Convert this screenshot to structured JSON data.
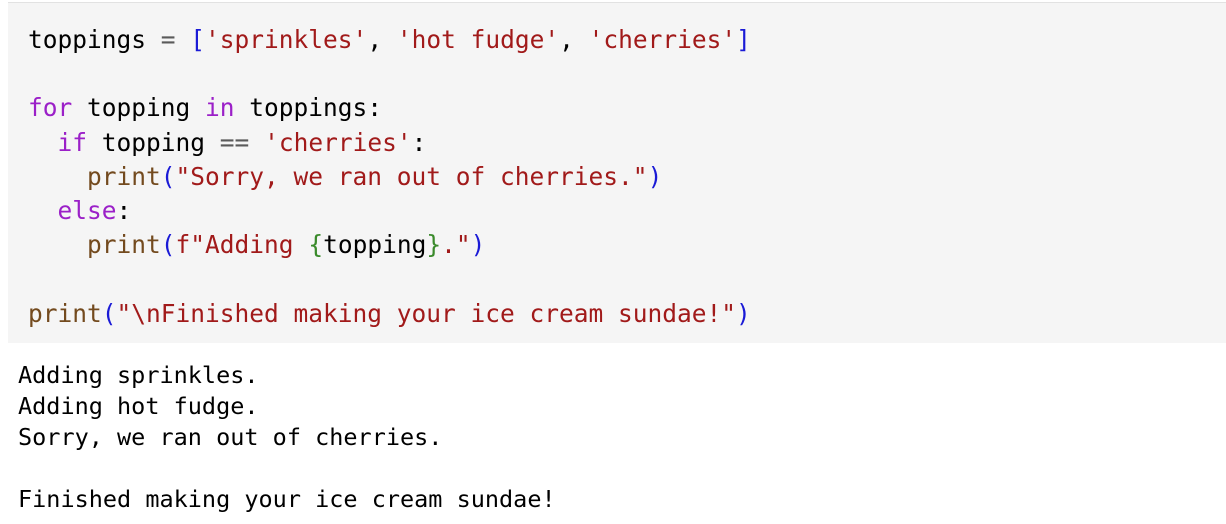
{
  "code_cell": {
    "line1": {
      "var": "toppings",
      "eq": " = ",
      "lbr": "[",
      "s1": "'sprinkles'",
      "c1": ", ",
      "s2": "'hot fudge'",
      "c2": ", ",
      "s3": "'cherries'",
      "rbr": "]"
    },
    "line3": {
      "kw_for": "for",
      "t1": " topping ",
      "kw_in": "in",
      "t2": " toppings:"
    },
    "line4": {
      "indent": "  ",
      "kw_if": "if",
      "t1": " topping ",
      "op": "==",
      "t2": " ",
      "str": "'cherries'",
      "colon": ":"
    },
    "line5": {
      "indent": "    ",
      "fn": "print",
      "lp": "(",
      "str": "\"Sorry, we ran out of cherries.\"",
      "rp": ")"
    },
    "line6": {
      "indent": "  ",
      "kw_else": "else",
      "colon": ":"
    },
    "line7": {
      "indent": "    ",
      "fn": "print",
      "lp": "(",
      "str_a": "f\"Adding ",
      "lcb": "{",
      "var": "topping",
      "rcb": "}",
      "str_b": ".\"",
      "rp": ")"
    },
    "line9": {
      "fn": "print",
      "lp": "(",
      "str": "\"\\nFinished making your ice cream sundae!\"",
      "rp": ")"
    }
  },
  "output_cell": {
    "lines": [
      "Adding sprinkles.",
      "Adding hot fudge.",
      "Sorry, we ran out of cherries.",
      "",
      "Finished making your ice cream sundae!"
    ]
  },
  "colors": {
    "keyword": "#9b20c8",
    "builtin": "#734a1e",
    "string": "#a11a1a",
    "bracket": "#1a1ad6",
    "fstring_field": "#3a8a2b",
    "input_background": "#f5f5f5"
  }
}
